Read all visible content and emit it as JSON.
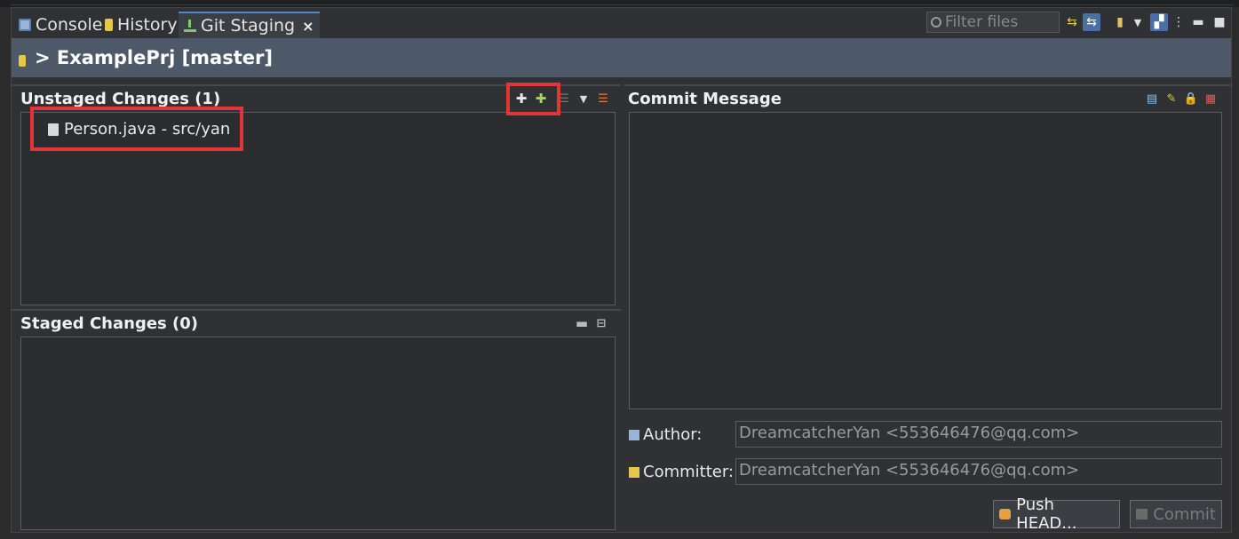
{
  "tabs": [
    {
      "label": "Console",
      "icon": "console-icon"
    },
    {
      "label": "History",
      "icon": "history-icon"
    },
    {
      "label": "Git Staging",
      "icon": "git-staging-icon",
      "active": true,
      "close": "×"
    }
  ],
  "filter": {
    "placeholder": "Filter files"
  },
  "repo": {
    "title": "> ExamplePrj [master]"
  },
  "unstaged": {
    "header": "Unstaged Changes (1)",
    "files": [
      {
        "label": "Person.java - src/yan"
      }
    ]
  },
  "staged": {
    "header": "Staged Changes (0)",
    "files": []
  },
  "commit": {
    "header": "Commit Message",
    "message": "",
    "author_label": "Author:",
    "author_value": "DreamcatcherYan <553646476@qq.com>",
    "committer_label": "Committer:",
    "committer_value": "DreamcatcherYan <553646476@qq.com>",
    "push_label": "Push HEAD...",
    "commit_label": "Commit"
  },
  "colors": {
    "highlight": "#e23636",
    "header_bg": "#4d5968",
    "active_tab_border": "#5b84c4"
  }
}
